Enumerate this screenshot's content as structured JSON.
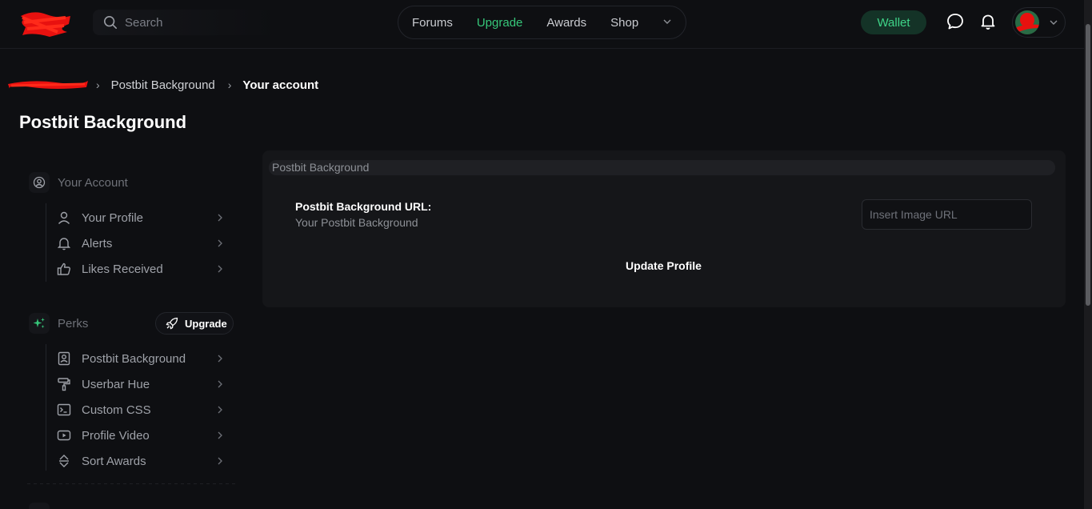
{
  "header": {
    "search_placeholder": "Search",
    "nav": [
      "Forums",
      "Upgrade",
      "Awards",
      "Shop"
    ],
    "wallet_label": "Wallet",
    "accent_color": "#36c77a",
    "icons": [
      "search-icon",
      "chevron-down-icon",
      "chat-bubble-icon",
      "bell-icon"
    ]
  },
  "breadcrumb": {
    "items": [
      "Postbit Background",
      "Your account"
    ]
  },
  "page": {
    "title": "Postbit Background"
  },
  "sidebar": {
    "account_group": {
      "title": "Your Account",
      "items": [
        {
          "label": "Your Profile",
          "icon": "user-icon"
        },
        {
          "label": "Alerts",
          "icon": "bell-icon"
        },
        {
          "label": "Likes Received",
          "icon": "thumbs-up-icon"
        }
      ]
    },
    "perks_group": {
      "title": "Perks",
      "upgrade_label": "Upgrade",
      "items": [
        {
          "label": "Postbit Background",
          "icon": "portrait-icon"
        },
        {
          "label": "Userbar Hue",
          "icon": "paint-roller-icon"
        },
        {
          "label": "Custom CSS",
          "icon": "terminal-icon"
        },
        {
          "label": "Profile Video",
          "icon": "play-icon"
        },
        {
          "label": "Sort Awards",
          "icon": "sort-icon"
        }
      ]
    }
  },
  "panel": {
    "header": "Postbit Background",
    "field_label": "Postbit Background URL:",
    "field_description": "Your Postbit Background",
    "input_placeholder": "Insert Image URL",
    "input_value": "",
    "submit_label": "Update Profile"
  }
}
